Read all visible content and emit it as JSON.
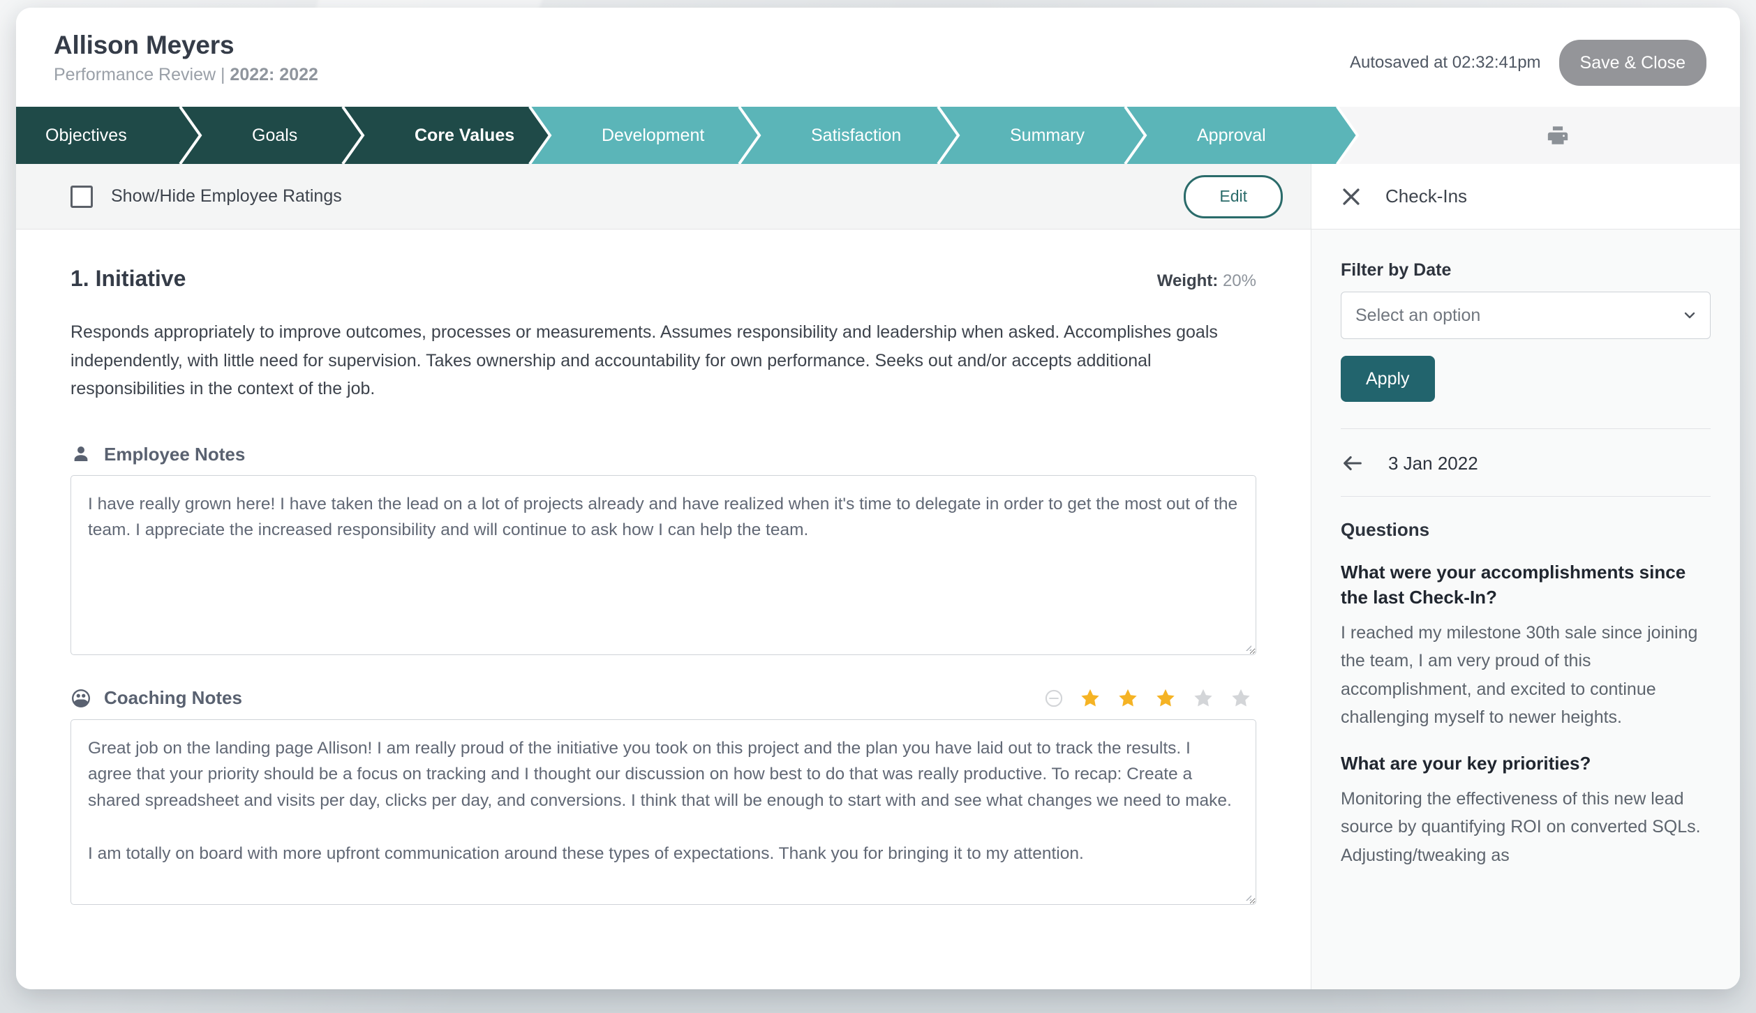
{
  "header": {
    "employee_name": "Allison Meyers",
    "review_type": "Performance Review | ",
    "review_cycle": "2022: 2022",
    "autosaved": "Autosaved at 02:32:41pm",
    "save_close_label": "Save & Close"
  },
  "stepper": {
    "steps": [
      {
        "label": "Objectives",
        "state": "done"
      },
      {
        "label": "Goals",
        "state": "done"
      },
      {
        "label": "Core Values",
        "state": "current"
      },
      {
        "label": "Development",
        "state": "todo"
      },
      {
        "label": "Satisfaction",
        "state": "todo"
      },
      {
        "label": "Summary",
        "state": "todo"
      },
      {
        "label": "Approval",
        "state": "todo"
      }
    ],
    "print_icon": "print-icon"
  },
  "toolbar": {
    "show_hide_label": "Show/Hide Employee Ratings",
    "edit_label": "Edit"
  },
  "section": {
    "title": "1. Initiative",
    "weight_label": "Weight:",
    "weight_value": "20%",
    "description": "Responds appropriately to improve outcomes, processes or measurements. Assumes responsibility and leadership when asked. Accomplishes goals independently, with little need for supervision. Takes ownership and accountability for own performance. Seeks out and/or accepts additional responsibilities in the context of the job."
  },
  "employee_notes": {
    "label": "Employee Notes",
    "icon": "person-icon",
    "value": "I have really grown here! I have taken the lead on a lot of projects already and have realized when it's time to delegate in order to get the most out of the team. I appreciate the increased responsibility and will continue to ask how I can help the team."
  },
  "coaching_notes": {
    "label": "Coaching Notes",
    "icon": "group-icon",
    "value": "Great job on the landing page Allison! I am really proud of the initiative you took on this project and the plan you have laid out to track the results. I agree that your priority should be a focus on tracking and I thought our discussion on how best to do that was really productive. To recap: Create a shared spreadsheet and visits per day, clicks per day, and conversions. I think that will be enough to start with and see what changes we need to make.\n\nI am totally on board with more upfront communication around these types of expectations. Thank you for bringing it to my attention.",
    "rating": 3,
    "rating_max": 5,
    "no_rating_icon": "minus-circle-icon"
  },
  "side_panel": {
    "title": "Check-Ins",
    "close_icon": "close-icon",
    "filter_label": "Filter by Date",
    "select_placeholder": "Select an option",
    "select_options": [
      "Select an option"
    ],
    "apply_label": "Apply",
    "back_icon": "arrow-left-icon",
    "current_date": "3 Jan 2022",
    "questions_heading": "Questions",
    "questions": [
      {
        "question": "What were your accomplishments since the last Check-In?",
        "answer": "I reached my milestone 30th sale since joining the team, I am very proud of this accomplishment, and excited to continue challenging myself to newer heights."
      },
      {
        "question": "What are your key priorities?",
        "answer": "Monitoring the effectiveness of this new lead source by quantifying ROI on converted SQLs. Adjusting/tweaking as"
      }
    ]
  },
  "colors": {
    "step_done": "#1f4a48",
    "step_todo": "#5bb5b8",
    "accent_teal": "#22646d",
    "star_gold": "#f5b324",
    "star_empty": "#d3d5d8",
    "save_gray": "#949599"
  }
}
